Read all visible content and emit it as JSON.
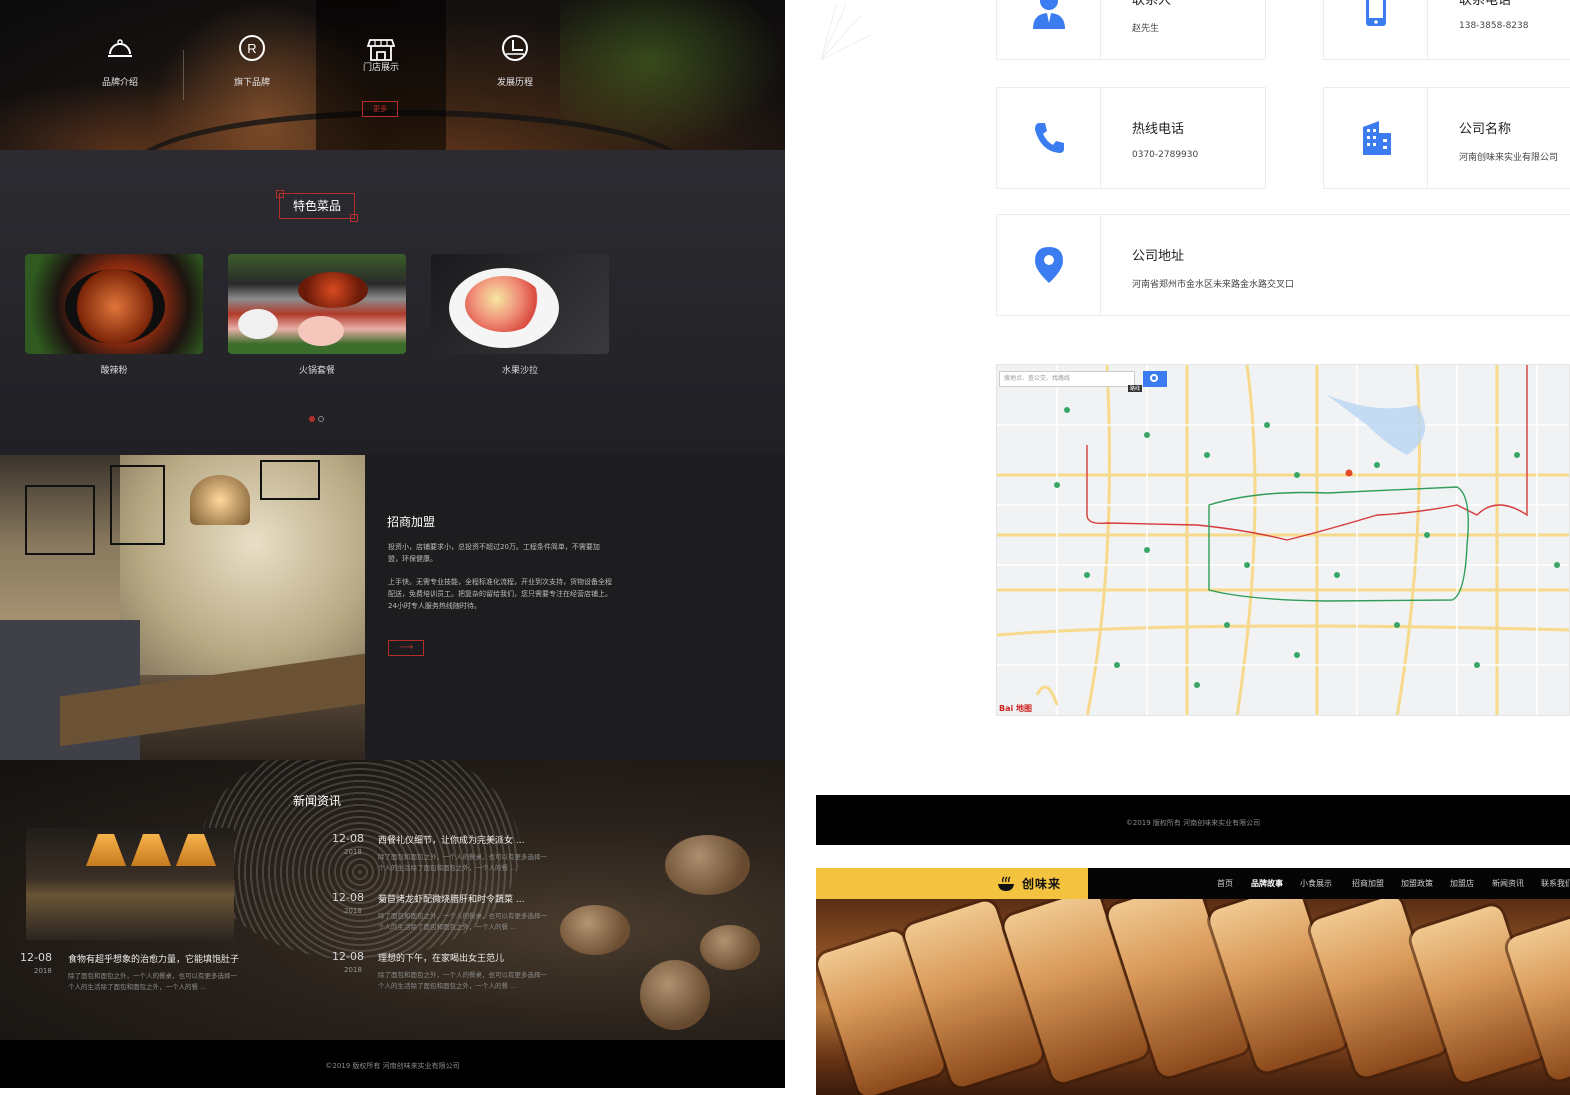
{
  "left_mockup": {
    "hero_nav": [
      {
        "label": "品牌介绍",
        "icon": "cloche-icon"
      },
      {
        "label": "旗下品牌",
        "icon": "registered-icon"
      },
      {
        "label": "门店展示",
        "icon": "storefront-icon"
      },
      {
        "label": "发展历程",
        "icon": "history-icon"
      }
    ],
    "more_label": "更多",
    "featured": {
      "title": "特色菜品",
      "dishes": [
        {
          "label": "酸辣粉"
        },
        {
          "label": "火锅套餐"
        },
        {
          "label": "水果沙拉"
        }
      ]
    },
    "join": {
      "title": "招商加盟",
      "paragraph1": "投资小，店铺要求小，总投资不超过20万。工程条件简单，不需要加盟，环保健康。",
      "paragraph2": "上手快。无需专业技能，全程标准化流程，开业到次支持，货物设备全程配送，免费培训员工。把复杂的留给我们，您只需要专注在经营店铺上。24小时专人服务热线随时待。",
      "arrow": "⟶"
    },
    "news": {
      "title": "新闻资讯",
      "items": [
        {
          "date": "12-08",
          "year": "2018",
          "headline": "西餐礼仪细节，让你成为完美派女 ...",
          "desc": "除了面包和面包之外，一个人的餐桌，也可以有更多选择一个人的生活除了面包和面包之外，一个人的餐 ..."
        },
        {
          "date": "12-08",
          "year": "2018",
          "headline": "菊苣烤龙虾配微烧腊肝和时令蔬菜 ...",
          "desc": "除了面包和面包之外，一个人的餐桌，也可以有更多选择一个人的生活除了面包和面包之外，一个人的餐 ..."
        },
        {
          "date": "12-08",
          "year": "2018",
          "headline": "食物有超乎想象的治愈力量，它能填饱肚子",
          "desc": "除了面包和面包之外，一个人的餐桌，也可以有更多选择一个人的生活除了面包和面包之外，一个人的餐 ..."
        },
        {
          "date": "12-08",
          "year": "2018",
          "headline": "理想的下午，在家喝出女王范儿",
          "desc": "除了面包和面包之外，一个人的餐桌，也可以有更多选择一个人的生活除了面包和面包之外，一个人的餐 ..."
        }
      ]
    },
    "footer": "©2019 版权所有 河南创味来实业有限公司"
  },
  "right_mockup": {
    "contact_cards": [
      {
        "title": "联系人",
        "value": "赵先生",
        "icon": "person-icon"
      },
      {
        "title": "联系电话",
        "value": "138-3858-8238",
        "icon": "mobile-phone-icon"
      },
      {
        "title": "热线电话",
        "value": "0370-2789930",
        "icon": "phone-handset-icon"
      },
      {
        "title": "公司名称",
        "value": "河南创味来实业有限公司",
        "icon": "building-icon"
      },
      {
        "title": "公司地址",
        "value": "河南省郑州市金水区未来路金水路交叉口",
        "icon": "location-pin-icon"
      }
    ],
    "map": {
      "search_placeholder": "搜地点、查公交、找路线",
      "route_label": "路线",
      "logo": "Bai 地图"
    },
    "footer": "©2019 版权所有 河南创味来实业有限公司",
    "header": {
      "brand": "创味来",
      "nav": [
        "首页",
        "品牌故事",
        "小食展示",
        "招商加盟",
        "加盟政策",
        "加盟店",
        "新闻资讯",
        "联系我们"
      ],
      "active_index": 1
    }
  },
  "colors": {
    "accent_red": "#b52e2e",
    "brand_yellow": "#f3c23e",
    "icon_blue": "#3b7cf0"
  }
}
